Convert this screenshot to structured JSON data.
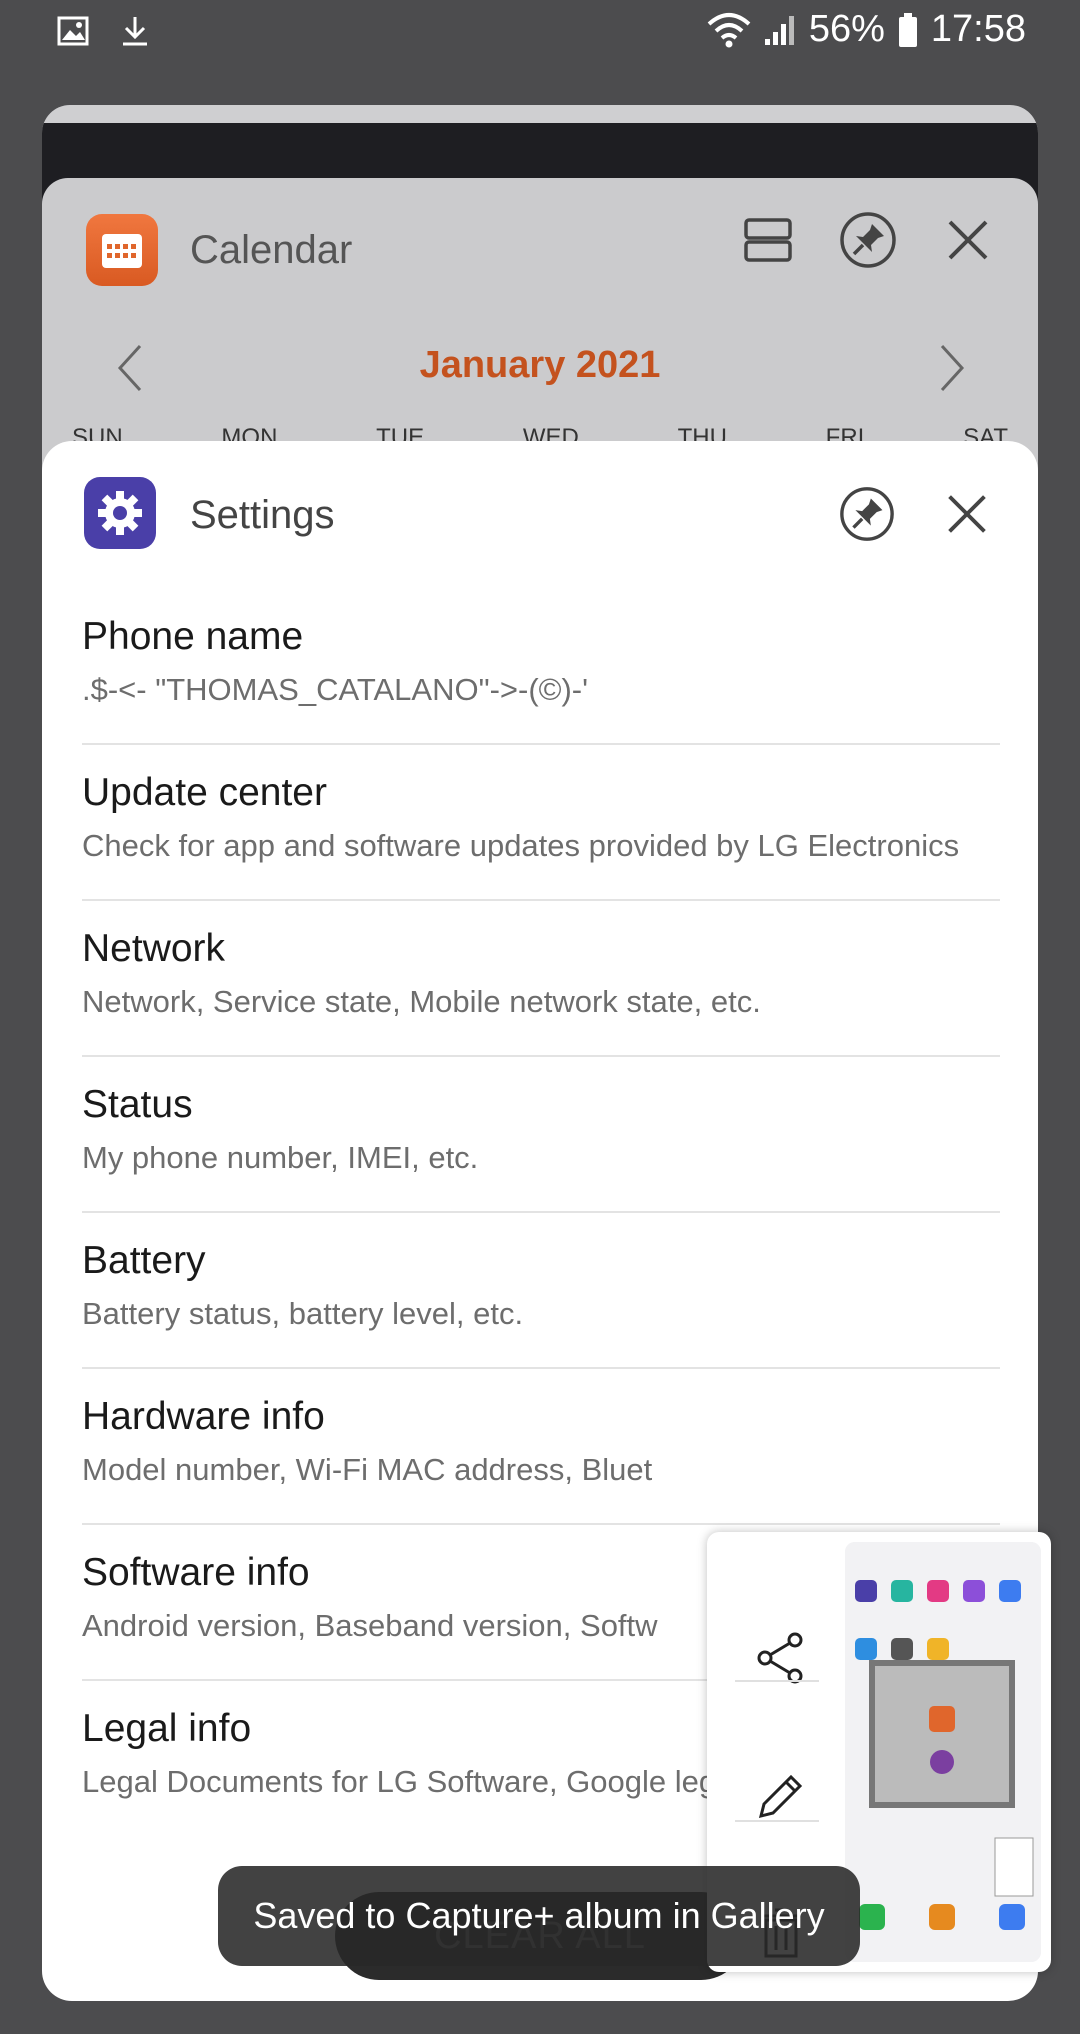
{
  "status_bar": {
    "battery": "56%",
    "time": "17:58",
    "icons": [
      "image-icon",
      "download-icon",
      "wifi-icon",
      "signal-icon",
      "battery-icon"
    ]
  },
  "calendar_card": {
    "title": "Calendar",
    "month": "January 2021",
    "weekdays": [
      "SUN",
      "MON",
      "TUE",
      "WED",
      "THU",
      "FRI",
      "SAT"
    ],
    "accent": "#c4521e"
  },
  "settings_card": {
    "title": "Settings",
    "items": [
      {
        "title": "Phone name",
        "subtitle": ".$-<- \"THOMAS_CATALANO\"->-(©)-'"
      },
      {
        "title": "Update center",
        "subtitle": "Check for app and software updates provided by LG Electronics"
      },
      {
        "title": "Network",
        "subtitle": "Network, Service state, Mobile network state, etc."
      },
      {
        "title": "Status",
        "subtitle": "My phone number, IMEI, etc."
      },
      {
        "title": "Battery",
        "subtitle": "Battery status, battery level, etc."
      },
      {
        "title": "Hardware info",
        "subtitle": "Model number, Wi-Fi MAC address, Bluet"
      },
      {
        "title": "Software info",
        "subtitle": "Android version, Baseband version, Softw"
      },
      {
        "title": "Legal info",
        "subtitle": "Legal Documents for LG Software, Google legal, etc."
      }
    ]
  },
  "capture_panel": {
    "icons": [
      "share-icon",
      "edit-icon",
      "delete-icon"
    ]
  },
  "clear_all": "CLEAR ALL",
  "toast": "Saved to Capture+ album in Gallery"
}
